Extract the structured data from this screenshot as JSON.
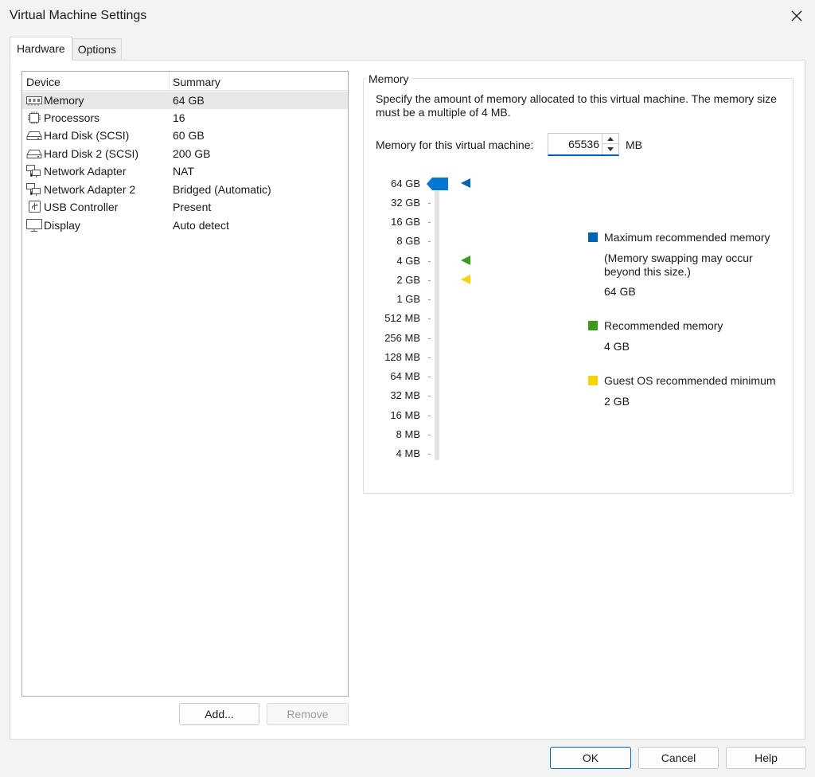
{
  "window": {
    "title": "Virtual Machine Settings",
    "close_icon": "close-icon"
  },
  "tabs": [
    {
      "label": "Hardware",
      "active": true
    },
    {
      "label": "Options",
      "active": false
    }
  ],
  "device_list": {
    "columns": [
      "Device",
      "Summary"
    ],
    "rows": [
      {
        "icon": "memory-icon",
        "device": "Memory",
        "summary": "64 GB",
        "selected": true
      },
      {
        "icon": "processor-icon",
        "device": "Processors",
        "summary": "16"
      },
      {
        "icon": "hard-disk-icon",
        "device": "Hard Disk (SCSI)",
        "summary": "60 GB"
      },
      {
        "icon": "hard-disk-icon",
        "device": "Hard Disk 2 (SCSI)",
        "summary": "200 GB"
      },
      {
        "icon": "network-adapter-icon",
        "device": "Network Adapter",
        "summary": "NAT"
      },
      {
        "icon": "network-adapter-icon",
        "device": "Network Adapter 2",
        "summary": "Bridged (Automatic)"
      },
      {
        "icon": "usb-controller-icon",
        "device": "USB Controller",
        "summary": "Present"
      },
      {
        "icon": "display-icon",
        "device": "Display",
        "summary": "Auto detect"
      }
    ],
    "add_button": "Add...",
    "remove_button": "Remove"
  },
  "memory": {
    "group_title": "Memory",
    "description": "Specify the amount of memory allocated to this virtual machine. The memory size must be a multiple of 4 MB.",
    "field_label": "Memory for this virtual machine:",
    "value": "65536",
    "unit": "MB",
    "scale": [
      "64 GB",
      "32 GB",
      "16 GB",
      "8 GB",
      "4 GB",
      "2 GB",
      "1 GB",
      "512 MB",
      "256 MB",
      "128 MB",
      "64 MB",
      "32 MB",
      "16 MB",
      "8 MB",
      "4 MB"
    ],
    "slider_value": "64 GB",
    "markers": [
      {
        "name": "max-recommended-marker",
        "level": "64 GB",
        "color": "#0063b1"
      },
      {
        "name": "recommended-marker",
        "level": "4 GB",
        "color": "#3c9a1f"
      },
      {
        "name": "guest-min-marker",
        "level": "2 GB",
        "color": "#f5d400"
      }
    ],
    "legend": [
      {
        "color": "#0063b1",
        "label": "Maximum recommended memory",
        "note": "(Memory swapping may occur beyond this size.)",
        "value": "64 GB"
      },
      {
        "color": "#3c9a1f",
        "label": "Recommended memory",
        "value": "4 GB"
      },
      {
        "color": "#f5d400",
        "label": "Guest OS recommended minimum",
        "value": "2 GB"
      }
    ]
  },
  "footer": {
    "ok": "OK",
    "cancel": "Cancel",
    "help": "Help"
  }
}
